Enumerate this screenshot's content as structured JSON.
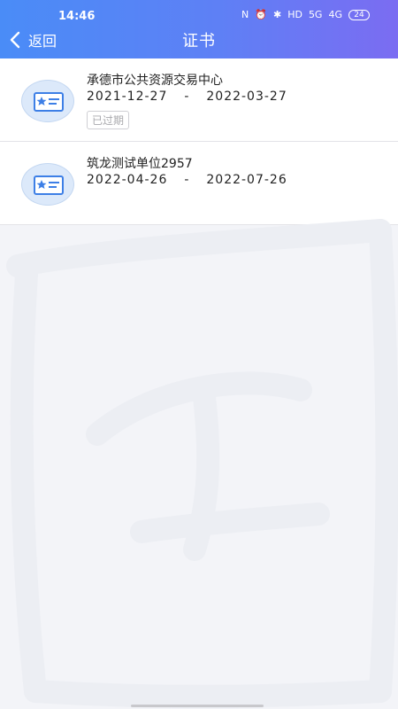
{
  "status_bar": {
    "time": "14:46",
    "icons": [
      "N",
      "⏰",
      "✱",
      "HD",
      "5G",
      "4G"
    ],
    "battery": "24"
  },
  "nav": {
    "back_label": "返回",
    "title": "证书"
  },
  "certificates": [
    {
      "name": "承德市公共资源交易中心",
      "start": "2021-12-27",
      "separator": "-",
      "end": "2022-03-27",
      "status": "已过期"
    },
    {
      "name": "筑龙测试单位2957",
      "start": "2022-04-26",
      "separator": "-",
      "end": "2022-07-26"
    }
  ],
  "colors": {
    "header_start": "#4a8cf7",
    "header_end": "#7b6cf2",
    "icon_accent": "#3d7fe6",
    "background": "#f3f4f8"
  }
}
